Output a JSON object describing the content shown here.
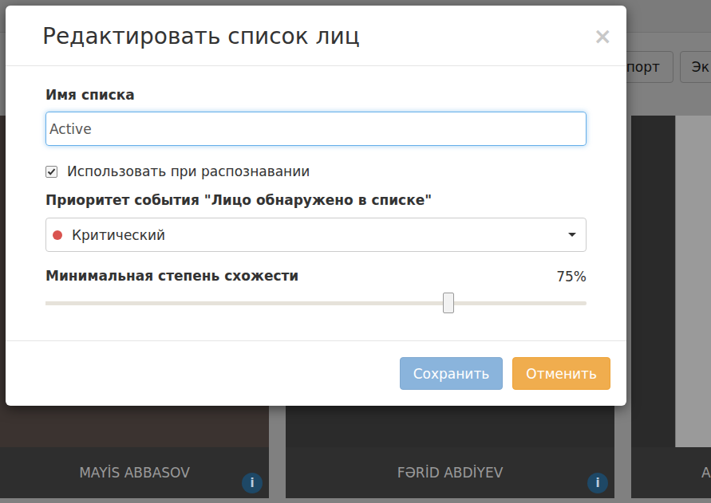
{
  "background": {
    "toolbar_buttons": [
      {
        "label": "порт"
      },
      {
        "label": "Эк"
      }
    ],
    "cards": [
      {
        "name": "MAYİS ABBASOV",
        "info_icon": "i"
      },
      {
        "name": "FƏRİD ABDİYEV",
        "info_icon": "i"
      },
      {
        "name": "A"
      }
    ]
  },
  "dialog": {
    "title": "Редактировать список лиц",
    "close": "×",
    "name_field": {
      "label": "Имя списка",
      "value": "Active"
    },
    "checkbox": {
      "label": "Использовать при распознавании",
      "checked": true
    },
    "priority": {
      "label": "Приоритет события \"Лицо обнаружено в списке\"",
      "value": "Критический",
      "color": "#d9534f"
    },
    "similarity": {
      "label": "Минимальная степень схожести",
      "reading": "75%",
      "level": 0.745
    },
    "buttons": [
      {
        "label": "Сохранить",
        "kind": "primary",
        "disabled": true
      },
      {
        "label": "Отменить",
        "kind": "warning",
        "disabled": false
      }
    ]
  }
}
